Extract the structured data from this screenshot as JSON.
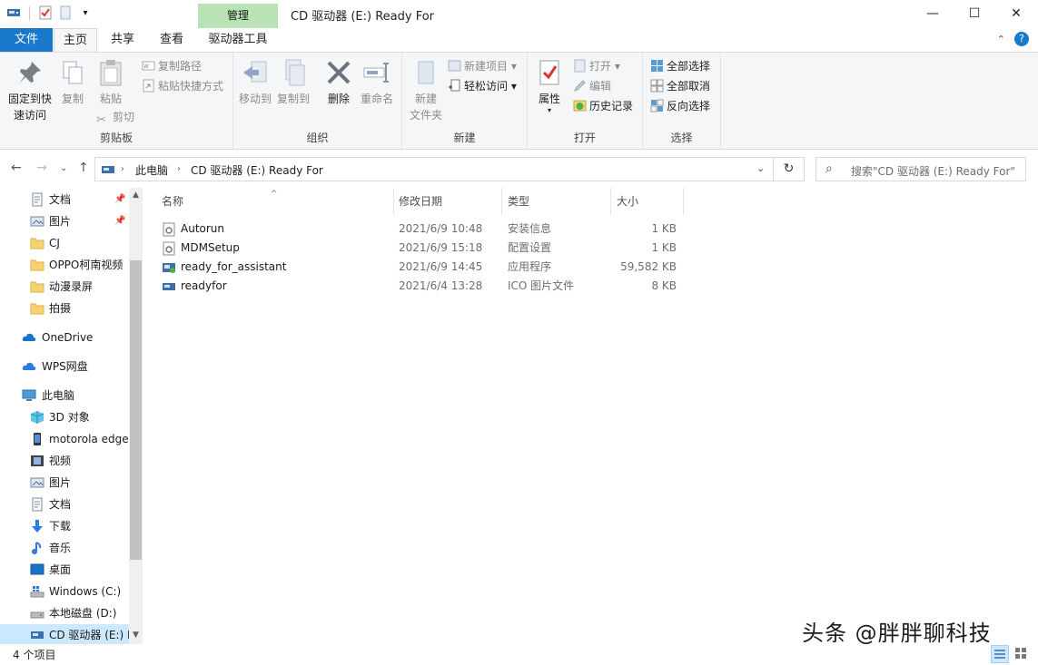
{
  "window": {
    "title": "CD 驱动器 (E:) Ready For",
    "context_tab": "管理",
    "controls": {
      "minimize": "—",
      "maximize": "☐",
      "close": "✕"
    }
  },
  "tabs": [
    "文件",
    "主页",
    "共享",
    "查看",
    "驱动器工具"
  ],
  "ribbon": {
    "clipboard": {
      "pin_label": "固定到快\n速访问",
      "copy_label": "复制",
      "paste_label": "粘贴",
      "copy_path": "复制路径",
      "paste_shortcut": "粘贴快捷方式",
      "cut": "剪切",
      "group_label": "剪贴板"
    },
    "organize": {
      "move_to": "移动到",
      "copy_to": "复制到",
      "delete": "删除",
      "rename": "重命名",
      "group_label": "组织"
    },
    "new": {
      "new_folder": "新建\n文件夹",
      "new_item": "新建项目",
      "easy_access": "轻松访问",
      "group_label": "新建"
    },
    "open": {
      "properties": "属性",
      "open": "打开",
      "edit": "编辑",
      "history": "历史记录",
      "group_label": "打开"
    },
    "select": {
      "select_all": "全部选择",
      "select_none": "全部取消",
      "invert": "反向选择",
      "group_label": "选择"
    }
  },
  "address": {
    "root": "此电脑",
    "current": "CD 驱动器 (E:) Ready For"
  },
  "search": {
    "placeholder": "搜索\"CD 驱动器 (E:) Ready For\""
  },
  "nav": {
    "quick_access": [
      {
        "label": "文档",
        "pinned": true
      },
      {
        "label": "图片",
        "pinned": true
      },
      {
        "label": "CJ"
      },
      {
        "label": "OPPO柯南视频"
      },
      {
        "label": "动漫录屏"
      },
      {
        "label": "拍摄"
      }
    ],
    "onedrive": "OneDrive",
    "wps": "WPS网盘",
    "this_pc": "此电脑",
    "pc_items": [
      "3D 对象",
      "motorola edge",
      "视频",
      "图片",
      "文档",
      "下载",
      "音乐",
      "桌面",
      "Windows (C:)",
      "本地磁盘 (D:)",
      "CD 驱动器 (E:) R"
    ]
  },
  "columns": {
    "name": "名称",
    "date": "修改日期",
    "type": "类型",
    "size": "大小"
  },
  "files": [
    {
      "name": "Autorun",
      "date": "2021/6/9 10:48",
      "type": "安装信息",
      "size": "1 KB"
    },
    {
      "name": "MDMSetup",
      "date": "2021/6/9 15:18",
      "type": "配置设置",
      "size": "1 KB"
    },
    {
      "name": "ready_for_assistant",
      "date": "2021/6/9 14:45",
      "type": "应用程序",
      "size": "59,582 KB"
    },
    {
      "name": "readyfor",
      "date": "2021/6/4 13:28",
      "type": "ICO 图片文件",
      "size": "8 KB"
    }
  ],
  "status": {
    "count": "4 个项目"
  },
  "watermark": "头条 @胖胖聊科技",
  "colors": {
    "accent": "#1979ca",
    "context_tab": "#b9e3b4",
    "selected": "#cce8ff"
  }
}
